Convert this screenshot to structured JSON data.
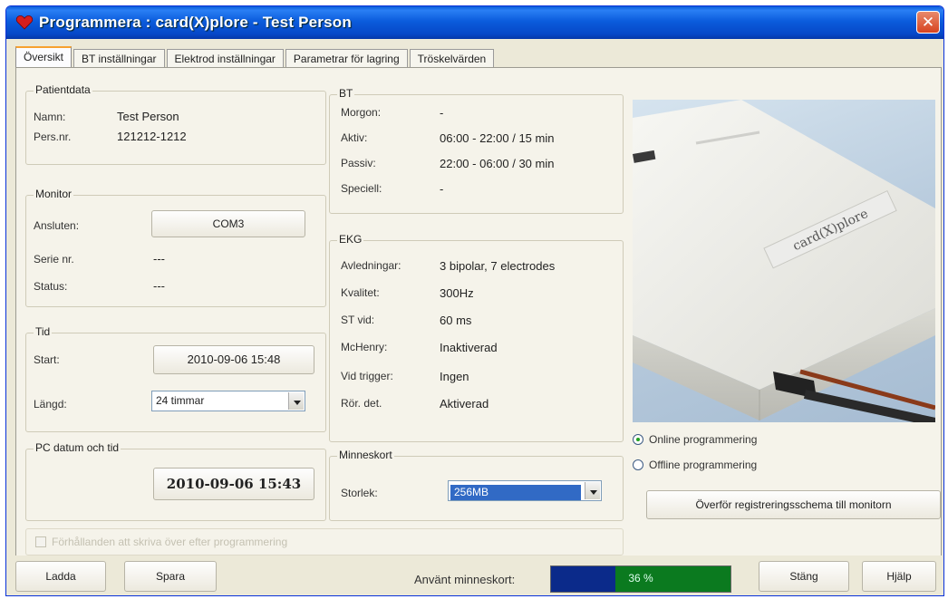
{
  "window": {
    "title": "Programmera : card(X)plore - Test Person"
  },
  "tabs": [
    {
      "label": "Översikt"
    },
    {
      "label": "BT inställningar"
    },
    {
      "label": "Elektrod inställningar"
    },
    {
      "label": "Parametrar för lagring"
    },
    {
      "label": "Tröskelvärden"
    }
  ],
  "patient": {
    "title": "Patientdata",
    "name_label": "Namn:",
    "name_value": "Test Person",
    "persnr_label": "Pers.nr.",
    "persnr_value": "121212-1212"
  },
  "monitor": {
    "title": "Monitor",
    "connected_label": "Ansluten:",
    "connected_value": "COM3",
    "serial_label": "Serie nr.",
    "serial_value": "---",
    "status_label": "Status:",
    "status_value": "---"
  },
  "tid": {
    "title": "Tid",
    "start_label": "Start:",
    "start_value": "2010-09-06 15:48",
    "length_label": "Längd:",
    "length_value": "24 timmar"
  },
  "pc": {
    "title": "PC datum och tid",
    "datetime": "2010-09-06 15:43"
  },
  "bt": {
    "title": "BT",
    "rows": [
      {
        "label": "Morgon:",
        "value": "-"
      },
      {
        "label": "Aktiv:",
        "value": "06:00 - 22:00 / 15 min"
      },
      {
        "label": "Passiv:",
        "value": "22:00 - 06:00 / 30 min"
      },
      {
        "label": "Speciell:",
        "value": "-"
      }
    ]
  },
  "ekg": {
    "title": "EKG",
    "rows": [
      {
        "label": "Avledningar:",
        "value": "3 bipolar, 7 electrodes"
      },
      {
        "label": "Kvalitet:",
        "value": "300Hz"
      },
      {
        "label": "ST vid:",
        "value": "60 ms"
      },
      {
        "label": "McHenry:",
        "value": "Inaktiverad"
      },
      {
        "label": "Vid trigger:",
        "value": "Ingen"
      },
      {
        "label": "Rör. det.",
        "value": "Aktiverad"
      }
    ]
  },
  "memory_card": {
    "title": "Minneskort",
    "size_label": "Storlek:",
    "size_value": "256MB"
  },
  "device": {
    "brand_text": "card(X)plore"
  },
  "programming": {
    "online_label": "Online programmering",
    "offline_label": "Offline programmering",
    "online_selected": true,
    "transfer_button": "Överför registreringsschema till monitorn"
  },
  "erase_checkbox": {
    "label": "Förhållanden att skriva över efter programmering",
    "checked": false
  },
  "bottom": {
    "load_button": "Ladda",
    "save_button": "Spara",
    "memory_label": "Använt minneskort:",
    "memory_percent": 36,
    "memory_text": "36 %",
    "close_button": "Stäng",
    "help_button": "Hjälp"
  },
  "colors": {
    "title_bar": "#0b5cdc",
    "progress_used": "#0b2a8a",
    "progress_free": "#0b7a1f",
    "selection": "#316ac5"
  }
}
